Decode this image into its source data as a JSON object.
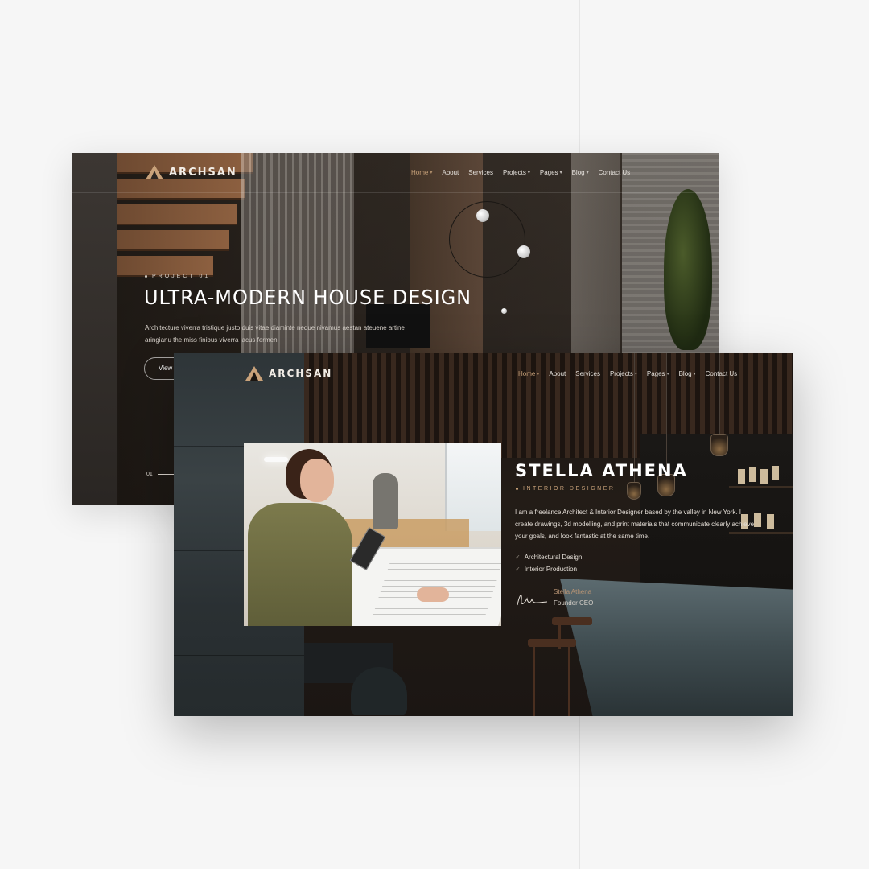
{
  "colors": {
    "accent": "#c9a27a",
    "page_bg": "#f6f6f6",
    "dark_bg": "#1b1613"
  },
  "back_screen": {
    "logo": {
      "icon": "triangle-logo-icon",
      "text": "ARCHSAN"
    },
    "nav": [
      {
        "label": "Home",
        "dropdown": true,
        "active": true
      },
      {
        "label": "About",
        "dropdown": false
      },
      {
        "label": "Services",
        "dropdown": false
      },
      {
        "label": "Projects",
        "dropdown": true
      },
      {
        "label": "Pages",
        "dropdown": true
      },
      {
        "label": "Blog",
        "dropdown": true
      },
      {
        "label": "Contact Us",
        "dropdown": false
      }
    ],
    "hero": {
      "eyebrow": "PROJECT 01",
      "title": "ULTRA-MODERN HOUSE DESIGN",
      "description": "Architecture viverra tristique justo duis vitae diaminte neque nivamus aestan ateuene artine aringianu the miss finibus viverra lacus fermen.",
      "button_label": "View",
      "slide_index": "01"
    }
  },
  "front_screen": {
    "logo": {
      "icon": "triangle-logo-icon",
      "text": "ARCHSAN"
    },
    "nav": [
      {
        "label": "Home",
        "dropdown": true,
        "active": true
      },
      {
        "label": "About",
        "dropdown": false
      },
      {
        "label": "Services",
        "dropdown": false
      },
      {
        "label": "Projects",
        "dropdown": true
      },
      {
        "label": "Pages",
        "dropdown": true
      },
      {
        "label": "Blog",
        "dropdown": true
      },
      {
        "label": "Contact Us",
        "dropdown": false
      }
    ],
    "bio": {
      "name": "STELLA ATHENA",
      "role": "INTERIOR DESIGNER",
      "text": "I am a freelance Architect & Interior Designer based by the valley in New York. I create drawings, 3d modelling, and print materials that communicate clearly achieve your goals, and look fantastic at the same time.",
      "list": [
        "Architectural Design",
        "Interior Production"
      ],
      "signature_name": "Stella Athena",
      "signature_role": "Founder CEO"
    }
  }
}
